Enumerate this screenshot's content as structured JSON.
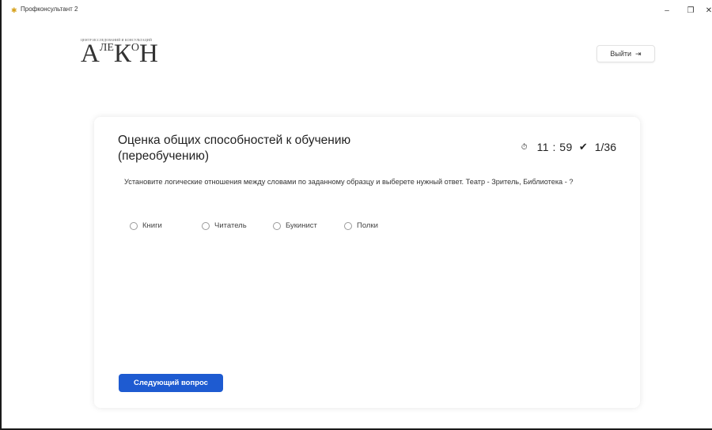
{
  "window": {
    "title": "Профконсультант 2",
    "app_icon": "star-icon",
    "controls": {
      "minimize": "–",
      "maximize": "❐",
      "close": "✕"
    }
  },
  "header": {
    "logo": {
      "small_text": "ЦЕНТР ИССЛЕДОВАНИЙ И КОНСУЛЬТАЦИЙ",
      "main_parts": [
        "А",
        "ЛЕ",
        "К",
        "О",
        "Н"
      ]
    },
    "logout": {
      "label": "Выйти",
      "icon": "logout-icon"
    }
  },
  "quiz": {
    "title": "Оценка общих способностей к обучению (переобучению)",
    "timer_icon": "stopwatch-icon",
    "timer": "11 : 59",
    "progress_icon": "check-icon",
    "progress": "1/36",
    "question": "Установите логические отношения между словами по заданному образцу и выберете нужный ответ. Театр - Зритель, Библиотека - ?",
    "options": [
      "Книги",
      "Читатель",
      "Букинист",
      "Полки"
    ],
    "selected_option": null,
    "next_button": "Следующий вопрос"
  },
  "colors": {
    "accent": "#1e5bd1",
    "app_icon": "#d6a11c"
  }
}
